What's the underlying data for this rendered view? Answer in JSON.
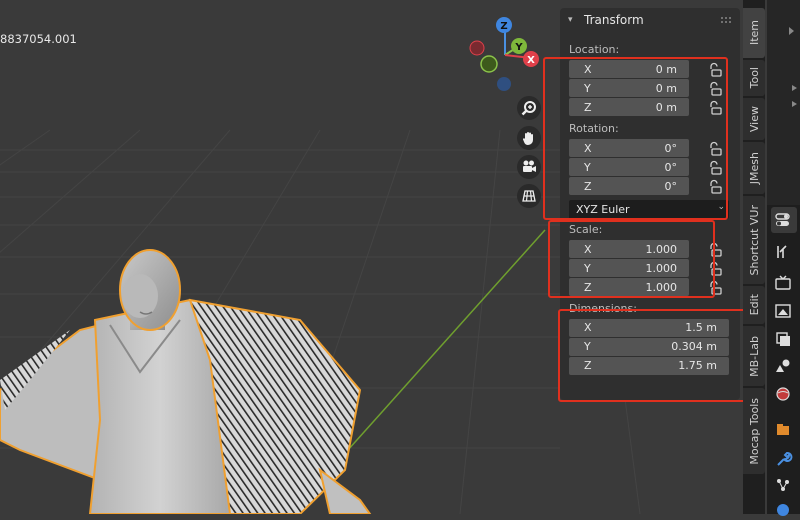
{
  "viewport": {
    "object_name": "8837054.001",
    "gizmo_axes": {
      "z": "Z",
      "y": "Y",
      "x": "X"
    }
  },
  "transform_panel": {
    "title": "Transform",
    "location": {
      "label": "Location:",
      "rows": [
        {
          "axis": "X",
          "value": "0 m"
        },
        {
          "axis": "Y",
          "value": "0 m"
        },
        {
          "axis": "Z",
          "value": "0 m"
        }
      ]
    },
    "rotation": {
      "label": "Rotation:",
      "rows": [
        {
          "axis": "X",
          "value": "0°"
        },
        {
          "axis": "Y",
          "value": "0°"
        },
        {
          "axis": "Z",
          "value": "0°"
        }
      ],
      "mode": "XYZ Euler"
    },
    "scale": {
      "label": "Scale:",
      "rows": [
        {
          "axis": "X",
          "value": "1.000"
        },
        {
          "axis": "Y",
          "value": "1.000"
        },
        {
          "axis": "Z",
          "value": "1.000"
        }
      ]
    },
    "dimensions": {
      "label": "Dimensions:",
      "rows": [
        {
          "axis": "X",
          "value": "1.5 m"
        },
        {
          "axis": "Y",
          "value": "0.304 m"
        },
        {
          "axis": "Z",
          "value": "1.75 m"
        }
      ]
    }
  },
  "sidebar_tabs": [
    "Item",
    "Tool",
    "View",
    "JMesh",
    "Shortcut VUr",
    "Edit",
    "MB-Lab",
    "Mocap Tools"
  ],
  "colors": {
    "highlight": "#e0301e",
    "selection_outline": "#f0a030",
    "axis_x": "#e0404a",
    "axis_y": "#8bc34a",
    "axis_z": "#4a90e2"
  },
  "viewport_tools": [
    "zoom-icon",
    "hand-icon",
    "camera-icon",
    "grid-view-icon"
  ]
}
